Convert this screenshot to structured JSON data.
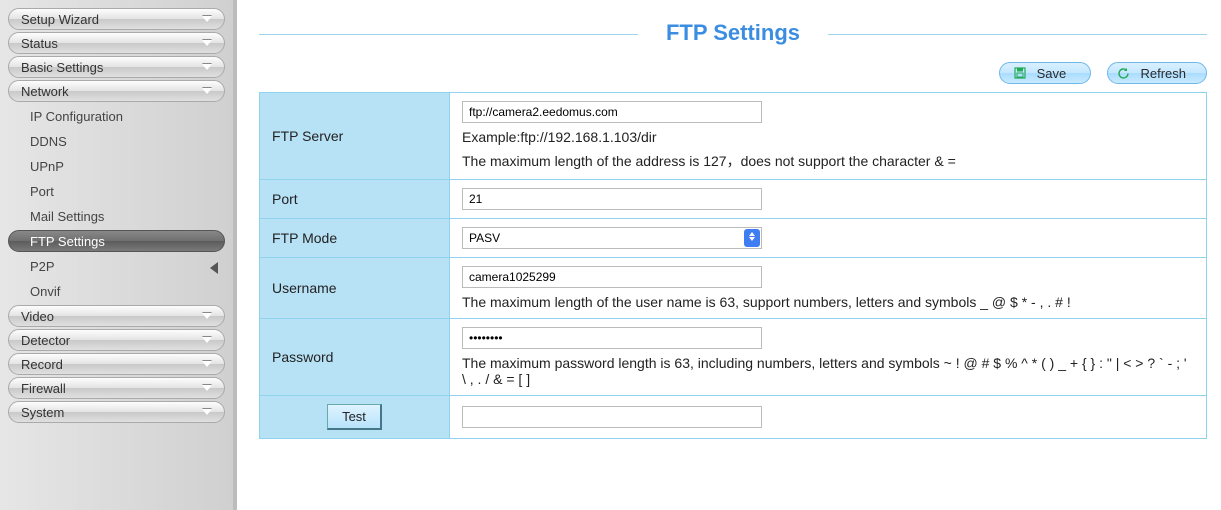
{
  "sidebar": {
    "groups_top": [
      {
        "label": "Setup Wizard"
      },
      {
        "label": "Status"
      },
      {
        "label": "Basic Settings"
      },
      {
        "label": "Network"
      }
    ],
    "network_items": [
      {
        "label": "IP Configuration"
      },
      {
        "label": "DDNS"
      },
      {
        "label": "UPnP"
      },
      {
        "label": "Port"
      },
      {
        "label": "Mail Settings"
      },
      {
        "label": "FTP Settings"
      },
      {
        "label": "P2P"
      },
      {
        "label": "Onvif"
      }
    ],
    "groups_bottom": [
      {
        "label": "Video"
      },
      {
        "label": "Detector"
      },
      {
        "label": "Record"
      },
      {
        "label": "Firewall"
      },
      {
        "label": "System"
      }
    ]
  },
  "title": "FTP Settings",
  "actions": {
    "save": "Save",
    "refresh": "Refresh"
  },
  "form": {
    "ftp_server": {
      "label": "FTP Server",
      "value": "ftp://camera2.eedomus.com",
      "hint1": "Example:ftp://192.168.1.103/dir",
      "hint2": "The maximum length of the address is 127，does not support the character & ="
    },
    "port": {
      "label": "Port",
      "value": "21"
    },
    "mode": {
      "label": "FTP Mode",
      "value": "PASV"
    },
    "username": {
      "label": "Username",
      "value": "camera1025299",
      "hint": "The maximum length of the user name is 63, support numbers, letters and symbols _ @ $ * - , . # !"
    },
    "password": {
      "label": "Password",
      "value": "••••••••",
      "hint": "The maximum password length is 63, including numbers, letters and symbols ~ ! @ # $ % ^ * ( ) _ + { } : \" | < > ? ` - ; ' \\ , . / & = [ ]"
    },
    "test": {
      "label": "Test",
      "value": ""
    }
  }
}
